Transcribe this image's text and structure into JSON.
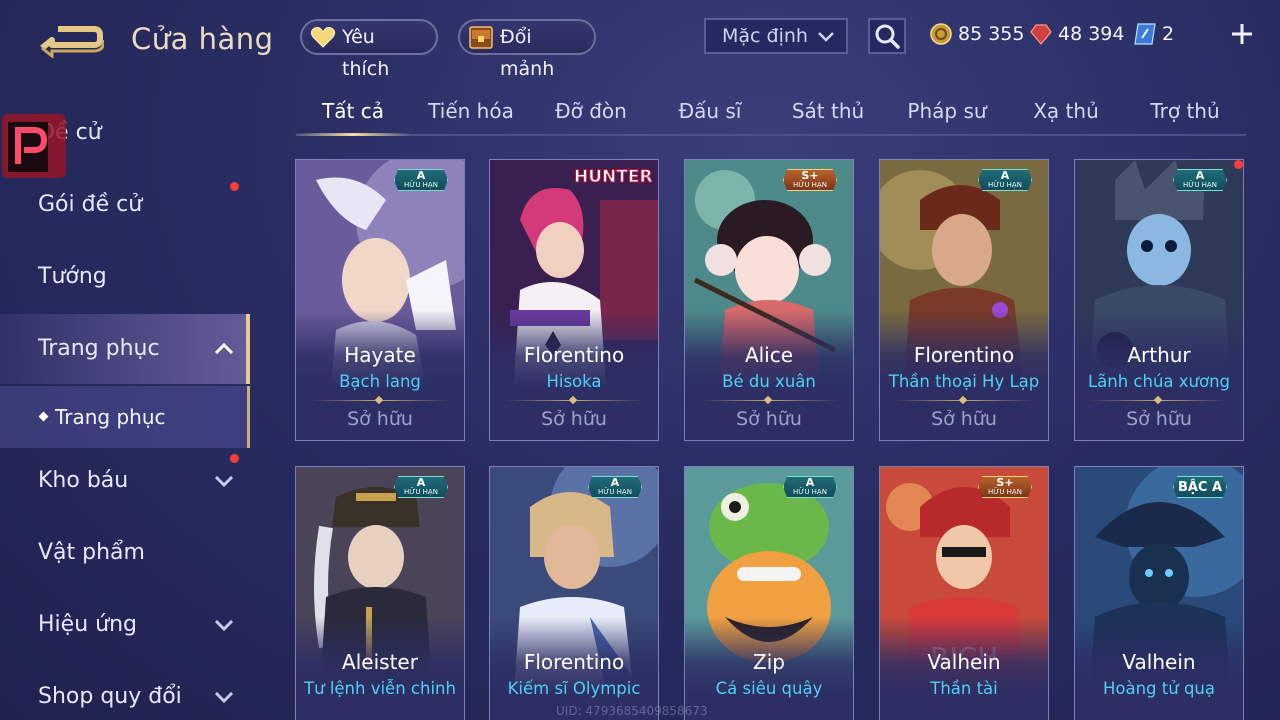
{
  "header": {
    "title": "Cửa hàng",
    "favorite_label": "Yêu thích",
    "shard_exchange_label": "Đổi mảnh",
    "sort_selected": "Mặc định",
    "currencies": [
      {
        "name": "gold-coin",
        "value": "85 355"
      },
      {
        "name": "ruby",
        "value": "48 394"
      },
      {
        "name": "voucher",
        "value": "2"
      }
    ],
    "colors": {
      "accent_gold": "#e9cc8c",
      "skin_name_cyan": "#4fd0f0",
      "notification_red": "#ff3b3b"
    }
  },
  "sidebar": {
    "items": [
      {
        "label": "Đề cử"
      },
      {
        "label": "Gói đề cử",
        "dot": true
      },
      {
        "label": "Tướng"
      },
      {
        "label": "Trang phục",
        "expanded": true
      },
      {
        "label": "Kho báu",
        "dot": true
      },
      {
        "label": "Vật phẩm"
      },
      {
        "label": "Hiệu ứng"
      },
      {
        "label": "Shop quy đổi"
      }
    ],
    "sub_item": "Trang phục"
  },
  "tabs": [
    "Tất cả",
    "Tiến hóa",
    "Đỡ đòn",
    "Đấu sĩ",
    "Sát thủ",
    "Pháp sư",
    "Xạ thủ",
    "Trợ thủ"
  ],
  "active_tab": "Tất cả",
  "cards": [
    {
      "hero": "Hayate",
      "skin": "Bạch lang",
      "status": "Sở hữu",
      "tier": "A",
      "tier_note": "HỮU HẠN"
    },
    {
      "hero": "Florentino",
      "skin": "Hisoka",
      "status": "Sở hữu",
      "tier": "",
      "tier_note": "",
      "brand": "HUNTER×HUNTER"
    },
    {
      "hero": "Alice",
      "skin": "Bé du xuân",
      "status": "Sở hữu",
      "tier": "S+",
      "tier_note": "HỮU HẠN"
    },
    {
      "hero": "Florentino",
      "skin": "Thần thoại Hy Lạp",
      "status": "Sở hữu",
      "tier": "A",
      "tier_note": "HỮU HẠN"
    },
    {
      "hero": "Arthur",
      "skin": "Lãnh chúa xương",
      "status": "Sở hữu",
      "tier": "A",
      "tier_note": "HỮU HẠN"
    },
    {
      "hero": "Aleister",
      "skin": "Tư lệnh viễn chinh",
      "tier": "A",
      "tier_note": "HỮU HẠN"
    },
    {
      "hero": "Florentino",
      "skin": "Kiếm sĩ Olympic",
      "tier": "A",
      "tier_note": "HỮU HẠN"
    },
    {
      "hero": "Zip",
      "skin": "Cá siêu quậy",
      "tier": "A",
      "tier_note": "HỮU HẠN"
    },
    {
      "hero": "Valhein",
      "skin": "Thần tài",
      "tier": "S+",
      "tier_note": "HỮU HẠN"
    },
    {
      "hero": "Valhein",
      "skin": "Hoàng tử quạ",
      "tier": "BẬC A",
      "tier_note": ""
    }
  ],
  "footer_uid": "UID: 4793685409858673"
}
